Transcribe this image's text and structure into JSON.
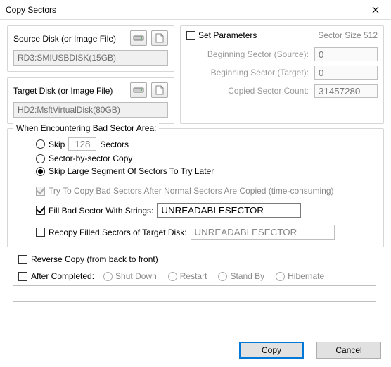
{
  "title": "Copy Sectors",
  "source": {
    "label": "Source Disk (or Image File)",
    "value": "RD3:SMIUSBDISK(15GB)"
  },
  "target": {
    "label": "Target Disk (or Image File)",
    "value": "HD2:MsftVirtualDisk(80GB)"
  },
  "params": {
    "set_label": "Set Parameters",
    "sector_size": "Sector Size 512",
    "beg_src_label": "Beginning Sector (Source):",
    "beg_src_value": "0",
    "beg_tgt_label": "Beginning Sector (Target):",
    "beg_tgt_value": "0",
    "count_label": "Copied Sector Count:",
    "count_value": "31457280"
  },
  "bad": {
    "legend": "When Encountering Bad Sector Area:",
    "skip_label": "Skip",
    "skip_value": "128",
    "skip_suffix": "Sectors",
    "sbs_label": "Sector-by-sector Copy",
    "large_label": "Skip Large Segment Of Sectors To Try Later",
    "try_label": "Try To Copy Bad Sectors After Normal Sectors Are Copied (time-consuming)",
    "fill_label": "Fill Bad Sector With Strings:",
    "fill_value": "UNREADABLESECTOR",
    "recopy_label": "Recopy Filled Sectors of Target Disk:",
    "recopy_value": "UNREADABLESECTOR"
  },
  "reverse_label": "Reverse Copy (from back to front)",
  "after": {
    "label": "After Completed:",
    "opts": [
      "Shut Down",
      "Restart",
      "Stand By",
      "Hibernate"
    ]
  },
  "buttons": {
    "copy": "Copy",
    "cancel": "Cancel"
  }
}
